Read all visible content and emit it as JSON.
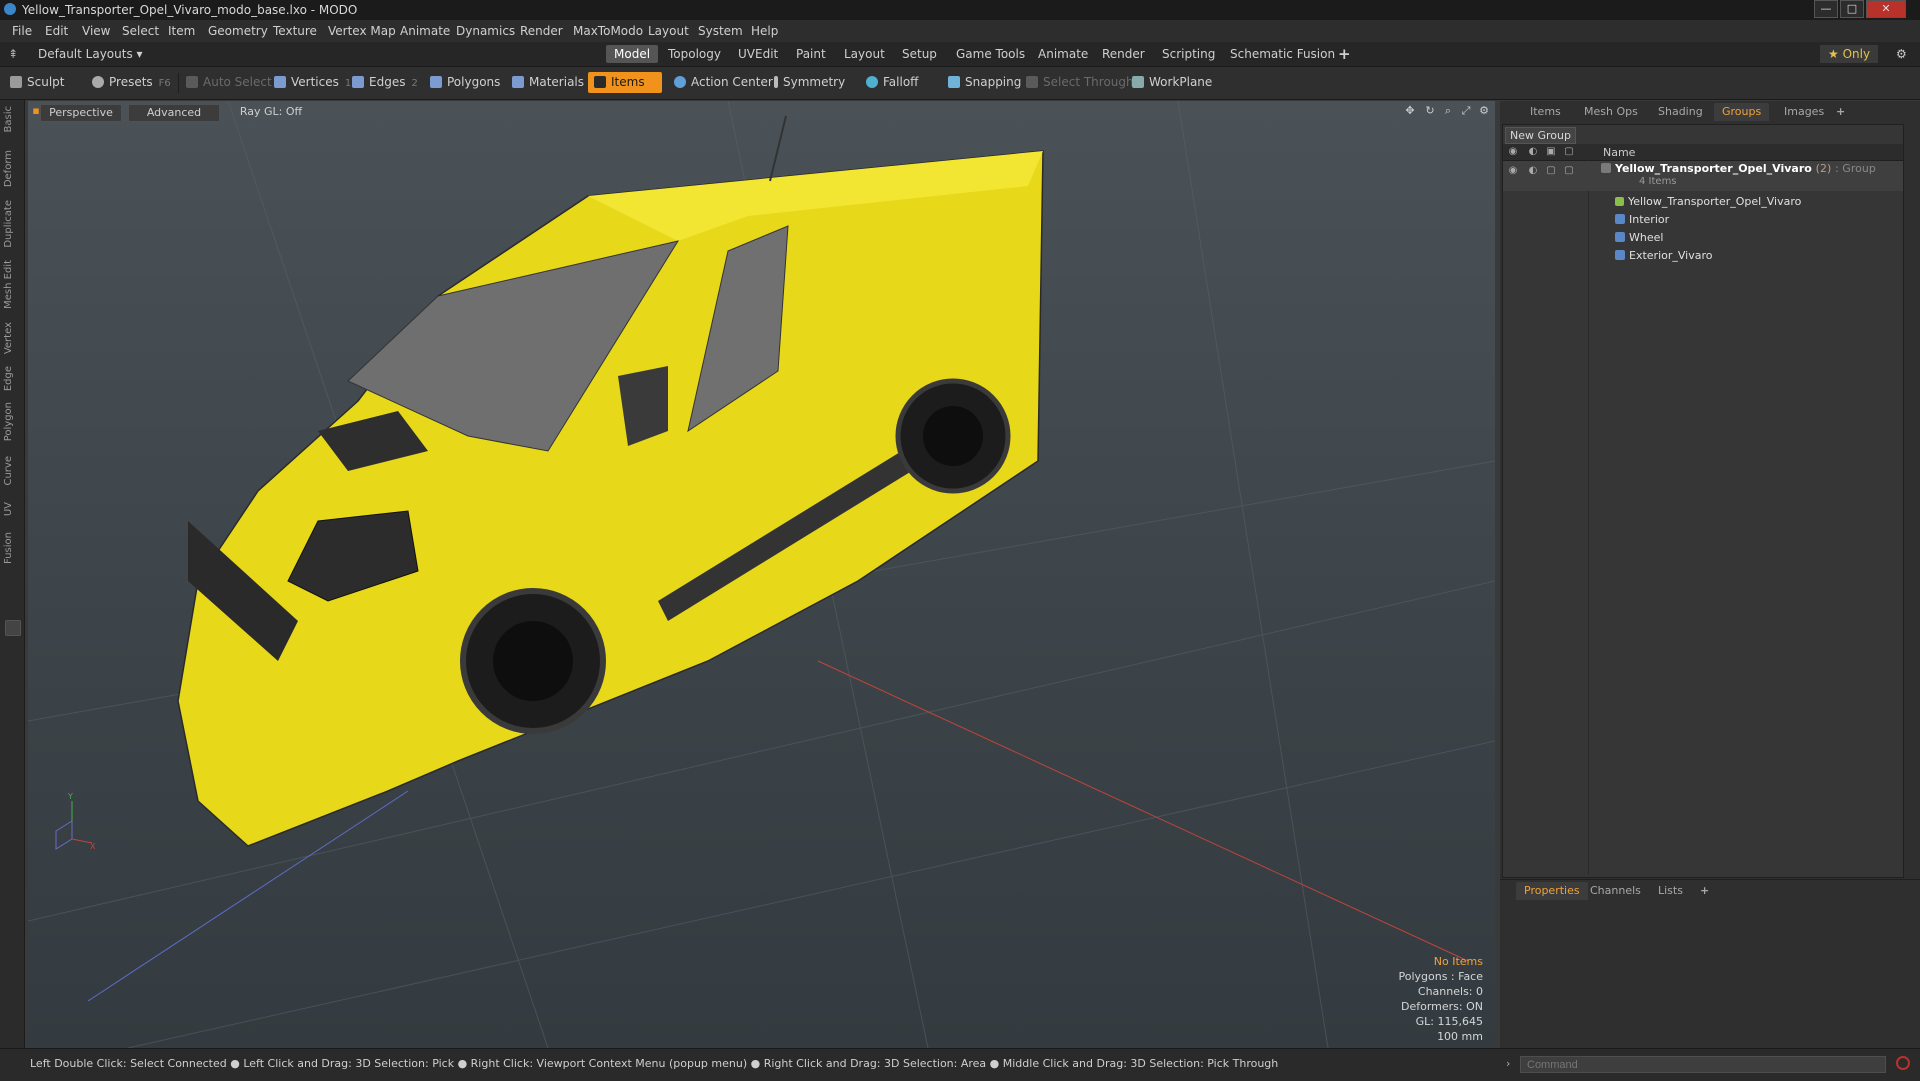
{
  "window": {
    "title": "Yellow_Transporter_Opel_Vivaro_modo_base.lxo - MODO"
  },
  "menu": [
    "File",
    "Edit",
    "View",
    "Select",
    "Item",
    "Geometry",
    "Texture",
    "Vertex Map",
    "Animate",
    "Dynamics",
    "Render",
    "MaxToModo",
    "Layout",
    "System",
    "Help"
  ],
  "layout": {
    "selector": "Default Layouts ▾",
    "tabs": [
      "Model",
      "Topology",
      "UVEdit",
      "Paint",
      "Layout",
      "Setup",
      "Game Tools",
      "Animate",
      "Render",
      "Scripting",
      "Schematic Fusion"
    ],
    "active_tab": "Model",
    "add": "+",
    "only": "★ Only"
  },
  "toolbar": {
    "sculpt": "Sculpt",
    "presets": "Presets",
    "presets_key": "F6",
    "auto_select": "Auto Select",
    "vertices": "Vertices",
    "vertices_key": "1",
    "edges": "Edges",
    "edges_key": "2",
    "polygons": "Polygons",
    "materials": "Materials",
    "items": "Items",
    "action_center": "Action Center",
    "symmetry": "Symmetry",
    "falloff": "Falloff",
    "snapping": "Snapping",
    "select_through": "Select Through",
    "workplane": "WorkPlane"
  },
  "left_tabs": [
    "Basic",
    "Deform",
    "Duplicate",
    "Mesh Edit",
    "Vertex",
    "Edge",
    "Polygon",
    "Curve",
    "UV",
    "Fusion"
  ],
  "viewport": {
    "view": "Perspective",
    "shading": "Advanced",
    "raygl": "Ray GL: Off",
    "stats": {
      "items": "No Items",
      "polygons": "Polygons : Face",
      "channels": "Channels: 0",
      "deformers": "Deformers: ON",
      "gl": "GL: 115,645",
      "scale": "100 mm"
    },
    "axis_x": "X",
    "axis_y": "Y"
  },
  "right_panel": {
    "tabs": [
      "Items",
      "Mesh Ops",
      "Shading",
      "Groups",
      "Images"
    ],
    "active_tab": "Groups",
    "add": "+",
    "new_group": "New Group",
    "column_name": "Name",
    "root": {
      "name": "Yellow_Transporter_Opel_Vivaro",
      "count": "(2)",
      "kind": ": Group",
      "sub": "4 Items"
    },
    "children": [
      "Yellow_Transporter_Opel_Vivaro",
      "Interior",
      "Wheel",
      "Exterior_Vivaro"
    ]
  },
  "bottom_panel": {
    "tabs": [
      "Properties",
      "Channels",
      "Lists"
    ],
    "active_tab": "Properties",
    "add": "+"
  },
  "status": "Left Double Click: Select Connected ● Left Click and Drag: 3D Selection: Pick ● Right Click: Viewport Context Menu (popup menu) ● Right Click and Drag: 3D Selection: Area ● Middle Click and Drag: 3D Selection: Pick Through",
  "command": {
    "placeholder": "Command"
  },
  "colors": {
    "accent": "#f0921b",
    "van_body": "#f2e41c",
    "selected_tab": "#f0a23a"
  }
}
